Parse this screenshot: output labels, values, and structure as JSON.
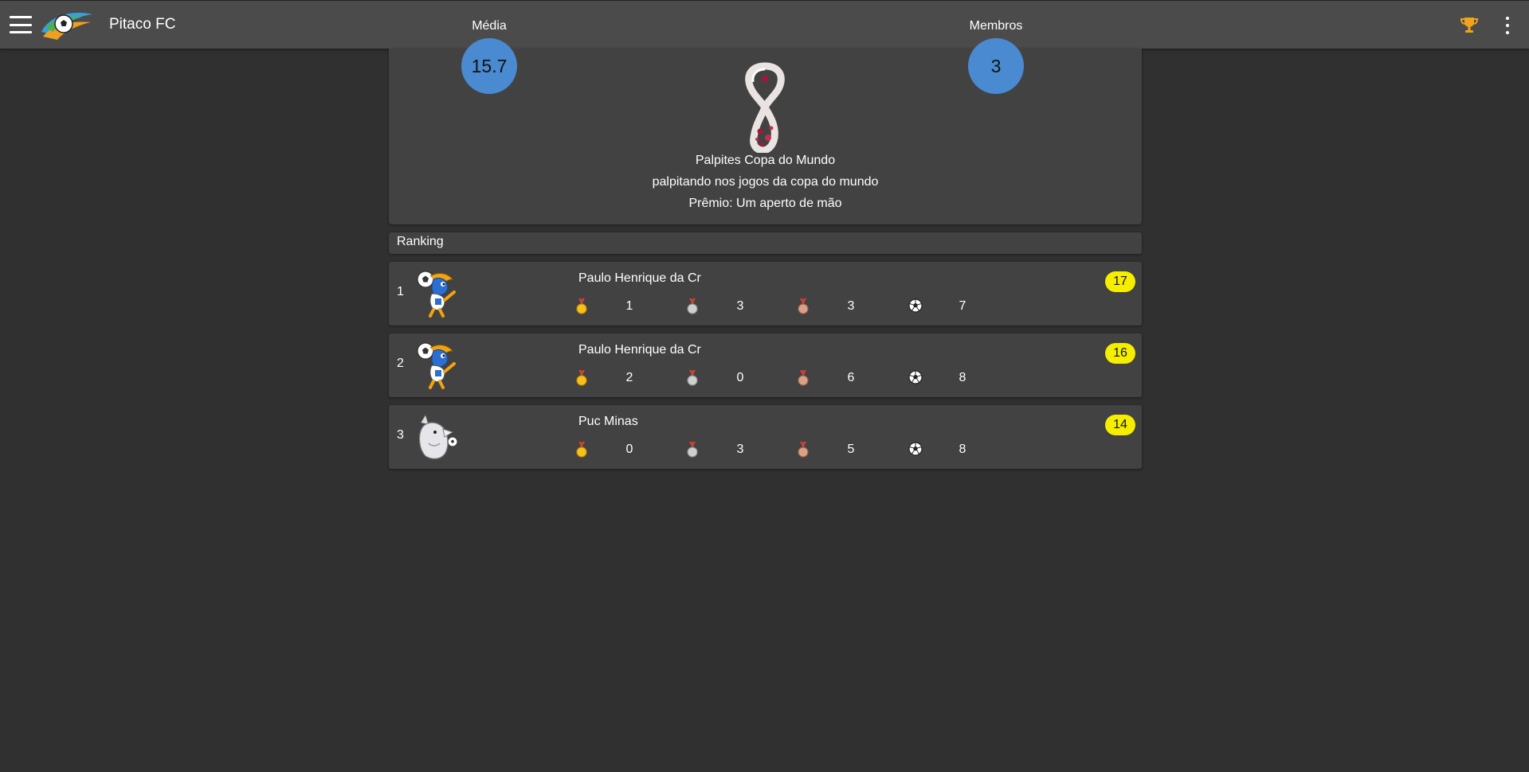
{
  "app": {
    "title": "Pitaco FC",
    "icons": {
      "menu": "menu-icon",
      "logo": "app-logo",
      "trophy": "trophy-icon",
      "more": "more-vert-icon"
    }
  },
  "league": {
    "media_label": "Média",
    "media_value": "15.7",
    "membros_label": "Membros",
    "membros_value": "3",
    "name": "Palpites Copa do Mundo",
    "description": "palpitando nos jogos da copa do mundo",
    "prize": "Prêmio: Um aperto de mão"
  },
  "ranking": {
    "title": "Ranking",
    "rows": [
      {
        "position": "1",
        "name": "Paulo Henrique da Cr",
        "points": "17",
        "gold": "1",
        "silver": "3",
        "bronze": "3",
        "goals": "7",
        "avatar": "fuleco-mascot"
      },
      {
        "position": "2",
        "name": "Paulo Henrique da Cr",
        "points": "16",
        "gold": "2",
        "silver": "0",
        "bronze": "6",
        "goals": "8",
        "avatar": "fuleco-mascot"
      },
      {
        "position": "3",
        "name": "Puc Minas",
        "points": "14",
        "gold": "0",
        "silver": "3",
        "bronze": "5",
        "goals": "8",
        "avatar": "wolf-mascot"
      }
    ]
  },
  "colors": {
    "background": "#303030",
    "appbar": "#4b4b4b",
    "card": "#424242",
    "stat_circle": "#4a8ad1",
    "points_badge": "#f6ee00"
  }
}
